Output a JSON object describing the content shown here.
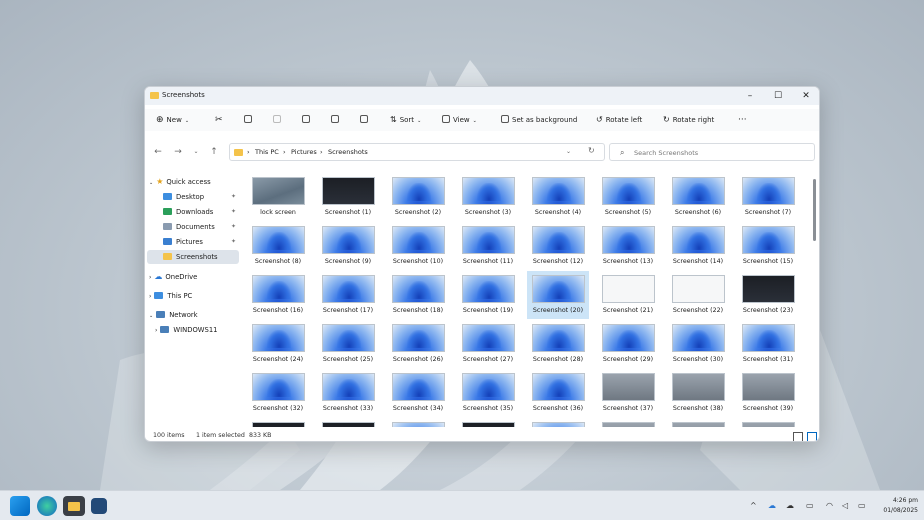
{
  "window": {
    "title": "Screenshots"
  },
  "toolbar": {
    "new_label": "New",
    "sort_label": "Sort",
    "view_label": "View",
    "set_background_label": "Set as background",
    "rotate_left_label": "Rotate left",
    "rotate_right_label": "Rotate right",
    "more_label": "···"
  },
  "address": {
    "crumbs": [
      "This PC",
      "Pictures",
      "Screenshots"
    ],
    "separator": "›"
  },
  "search": {
    "placeholder": "Search Screenshots"
  },
  "sidebar": {
    "quick_access": "Quick access",
    "items": [
      {
        "label": "Desktop"
      },
      {
        "label": "Downloads"
      },
      {
        "label": "Documents"
      },
      {
        "label": "Pictures"
      },
      {
        "label": "Screenshots"
      }
    ],
    "onedrive": "OneDrive",
    "this_pc": "This PC",
    "network": "Network",
    "windows11": "WINDOWS11"
  },
  "files": [
    {
      "name": "lock screen",
      "thumb": "lock"
    },
    {
      "name": "Screenshot (1)",
      "thumb": "dark"
    },
    {
      "name": "Screenshot (2)",
      "thumb": "blue"
    },
    {
      "name": "Screenshot (3)",
      "thumb": "blue"
    },
    {
      "name": "Screenshot (4)",
      "thumb": "blue"
    },
    {
      "name": "Screenshot (5)",
      "thumb": "blue"
    },
    {
      "name": "Screenshot (6)",
      "thumb": "blue"
    },
    {
      "name": "Screenshot (7)",
      "thumb": "blue"
    },
    {
      "name": "Screenshot (8)",
      "thumb": "blue"
    },
    {
      "name": "Screenshot (9)",
      "thumb": "blue"
    },
    {
      "name": "Screenshot (10)",
      "thumb": "blue"
    },
    {
      "name": "Screenshot (11)",
      "thumb": "blue"
    },
    {
      "name": "Screenshot (12)",
      "thumb": "blue"
    },
    {
      "name": "Screenshot (13)",
      "thumb": "blue"
    },
    {
      "name": "Screenshot (14)",
      "thumb": "blue"
    },
    {
      "name": "Screenshot (15)",
      "thumb": "blue"
    },
    {
      "name": "Screenshot (16)",
      "thumb": "blue"
    },
    {
      "name": "Screenshot (17)",
      "thumb": "blue"
    },
    {
      "name": "Screenshot (18)",
      "thumb": "blue"
    },
    {
      "name": "Screenshot (19)",
      "thumb": "blue"
    },
    {
      "name": "Screenshot (20)",
      "thumb": "blue"
    },
    {
      "name": "Screenshot (21)",
      "thumb": "white"
    },
    {
      "name": "Screenshot (22)",
      "thumb": "white"
    },
    {
      "name": "Screenshot (23)",
      "thumb": "dark"
    },
    {
      "name": "Screenshot (24)",
      "thumb": "blue"
    },
    {
      "name": "Screenshot (25)",
      "thumb": "blue"
    },
    {
      "name": "Screenshot (26)",
      "thumb": "blue"
    },
    {
      "name": "Screenshot (27)",
      "thumb": "blue"
    },
    {
      "name": "Screenshot (28)",
      "thumb": "blue"
    },
    {
      "name": "Screenshot (29)",
      "thumb": "blue"
    },
    {
      "name": "Screenshot (30)",
      "thumb": "blue"
    },
    {
      "name": "Screenshot (31)",
      "thumb": "blue"
    },
    {
      "name": "Screenshot (32)",
      "thumb": "blue"
    },
    {
      "name": "Screenshot (33)",
      "thumb": "blue"
    },
    {
      "name": "Screenshot (34)",
      "thumb": "blue"
    },
    {
      "name": "Screenshot (35)",
      "thumb": "blue"
    },
    {
      "name": "Screenshot (36)",
      "thumb": "blue"
    },
    {
      "name": "Screenshot (37)",
      "thumb": "gray"
    },
    {
      "name": "Screenshot (38)",
      "thumb": "gray"
    },
    {
      "name": "Screenshot (39)",
      "thumb": "gray"
    },
    {
      "name": "",
      "thumb": "dark"
    },
    {
      "name": "",
      "thumb": "dark"
    },
    {
      "name": "",
      "thumb": "blue"
    },
    {
      "name": "",
      "thumb": "dark"
    },
    {
      "name": "",
      "thumb": "blue"
    },
    {
      "name": "",
      "thumb": "gray"
    },
    {
      "name": "",
      "thumb": "gray"
    },
    {
      "name": "",
      "thumb": "gray"
    }
  ],
  "selected_file": "Screenshot (20)",
  "status": {
    "item_count": "100 items",
    "selection": "1 item selected",
    "size": "833 KB"
  },
  "clock": {
    "time": "4:26 pm",
    "date": "01/08/2025"
  },
  "colors": {
    "accent": "#0067c0",
    "folder": "#f4c34a",
    "selection": "#cce4f7"
  }
}
